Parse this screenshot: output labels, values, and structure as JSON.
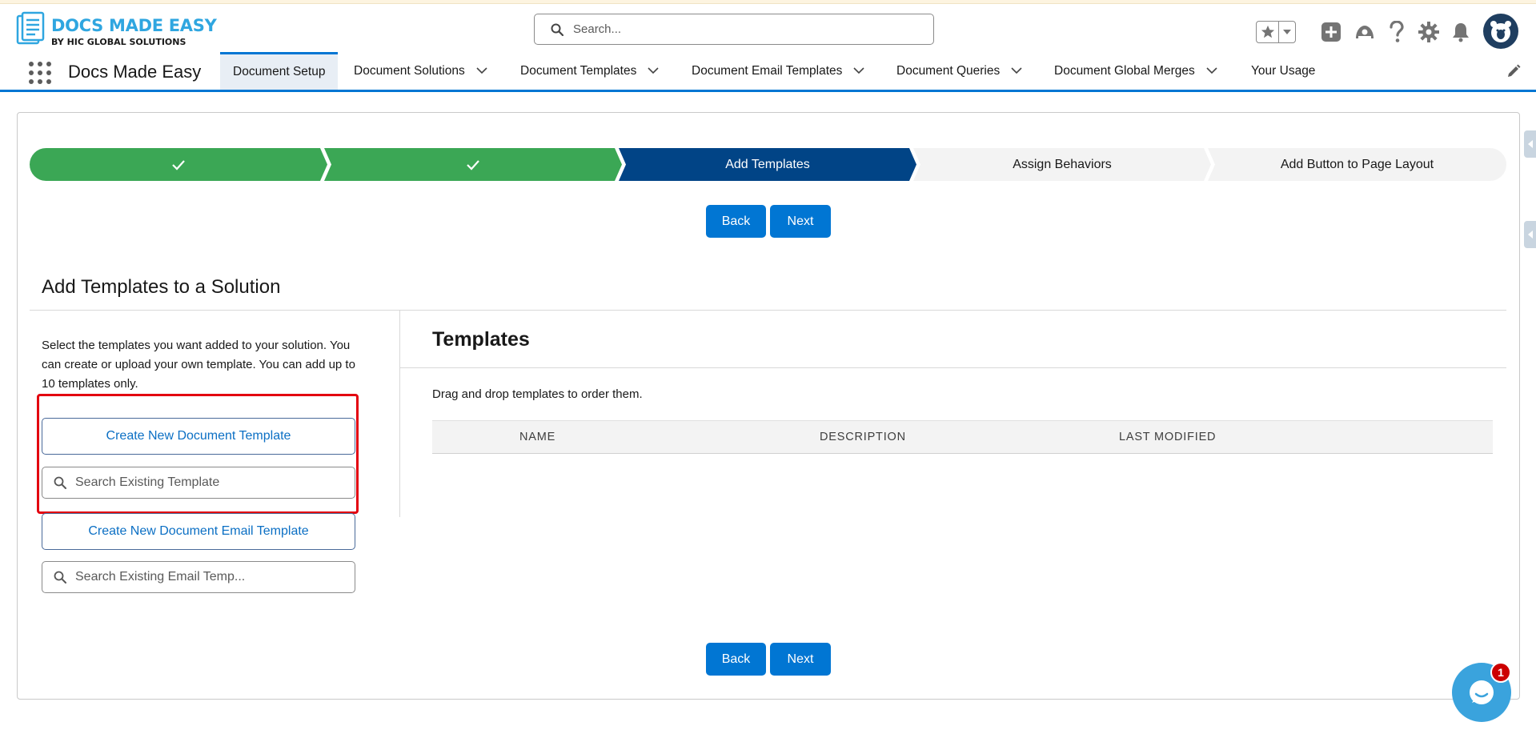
{
  "logo": {
    "title": "DOCS MADE EASY",
    "subtitle": "BY HIC GLOBAL SOLUTIONS"
  },
  "search": {
    "placeholder": "Search..."
  },
  "header_icons": [
    "favorites-star-icon",
    "favorites-dropdown-icon",
    "global-create-icon",
    "trailhead-icon",
    "help-icon",
    "setup-gear-icon",
    "notifications-bell-icon",
    "user-avatar"
  ],
  "nav": {
    "app_name": "Docs Made Easy",
    "tabs": [
      {
        "label": "Document Setup",
        "active": true,
        "has_dropdown": false
      },
      {
        "label": "Document Solutions",
        "has_dropdown": true
      },
      {
        "label": "Document Templates",
        "has_dropdown": true
      },
      {
        "label": "Document Email Templates",
        "has_dropdown": true
      },
      {
        "label": "Document Queries",
        "has_dropdown": true
      },
      {
        "label": "Document Global Merges",
        "has_dropdown": true
      },
      {
        "label": "Your Usage",
        "has_dropdown": false
      }
    ]
  },
  "path": {
    "steps": [
      {
        "label": "",
        "status": "complete"
      },
      {
        "label": "",
        "status": "complete"
      },
      {
        "label": "Add Templates",
        "status": "current"
      },
      {
        "label": "Assign Behaviors",
        "status": "incomplete"
      },
      {
        "label": "Add Button to Page Layout",
        "status": "incomplete"
      }
    ]
  },
  "buttons": {
    "back": "Back",
    "next": "Next"
  },
  "section": {
    "title": "Add Templates to a Solution",
    "description": "Select the templates you want added to your solution. You can create or upload your own template. You can add up to 10 templates only.",
    "create_doc_template": "Create New Document Template",
    "search_doc_template_placeholder": "Search Existing Template",
    "create_email_template": "Create New Document Email Template",
    "search_email_template_placeholder": "Search Existing Email Temp..."
  },
  "templates": {
    "title": "Templates",
    "hint": "Drag and drop templates to order them.",
    "columns": [
      "NAME",
      "DESCRIPTION",
      "LAST MODIFIED"
    ],
    "rows": []
  },
  "chat": {
    "badge_count": "1"
  },
  "colors": {
    "brand": "#0176d3",
    "complete": "#3ba755",
    "current": "#014486",
    "highlight": "#e3000f"
  }
}
